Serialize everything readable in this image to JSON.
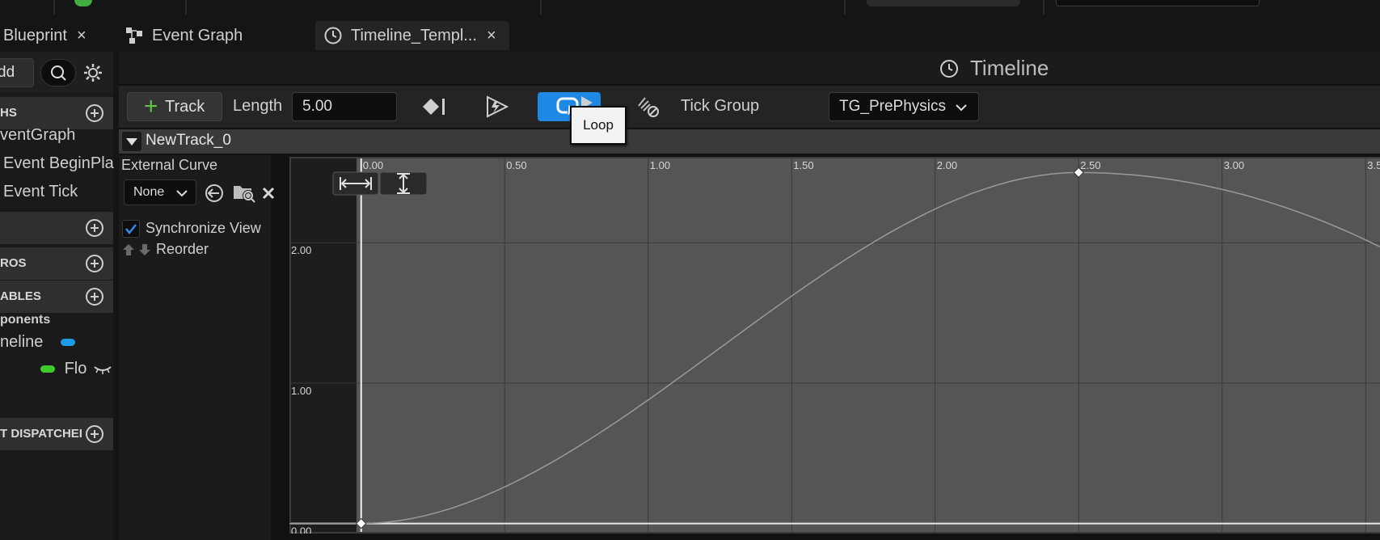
{
  "tabs": [
    {
      "label": "Blueprint",
      "close": "×"
    },
    {
      "label": "Event Graph"
    },
    {
      "label": "Timeline_Templ...",
      "close": "×"
    }
  ],
  "left": {
    "add_label": "dd",
    "sections": [
      {
        "label": "HS"
      },
      {
        "label": ""
      },
      {
        "label": "ROS"
      },
      {
        "label": "ABLES"
      },
      {
        "label": "T DISPATCHEI"
      }
    ],
    "items": {
      "eventgraph": "ventGraph",
      "beginplay": "Event BeginPla",
      "tick": "Event Tick",
      "components": "ponents",
      "timeline": "neline",
      "float": "Flo"
    }
  },
  "panel": {
    "title": "Timeline"
  },
  "toolbar": {
    "track_label": "Track",
    "length_label": "Length",
    "length_value": "5.00",
    "tick_group_label": "Tick Group",
    "tick_group_value": "TG_PrePhysics",
    "tooltip": "Loop"
  },
  "track": {
    "name": "NewTrack_0",
    "external_curve_label": "External Curve",
    "curve_value": "None",
    "sync_label": "Synchronize View",
    "reorder_label": "Reorder"
  },
  "chart_data": {
    "type": "line",
    "x_ticks": [
      "0.00",
      "0.50",
      "1.00",
      "1.50",
      "2.00",
      "2.50",
      "3.00",
      "3.5"
    ],
    "y_ticks": [
      "2.00",
      "1.00",
      "0.00"
    ],
    "keys": [
      {
        "x": 0.0,
        "y": 0.0
      },
      {
        "x": 2.5,
        "y": 2.5
      }
    ],
    "xlim": [
      -0.25,
      3.55
    ],
    "ylim": [
      -0.06,
      2.6
    ],
    "colors": {
      "curve": "#9a9a9a",
      "key": "#ffffff",
      "background": "#555555"
    }
  }
}
